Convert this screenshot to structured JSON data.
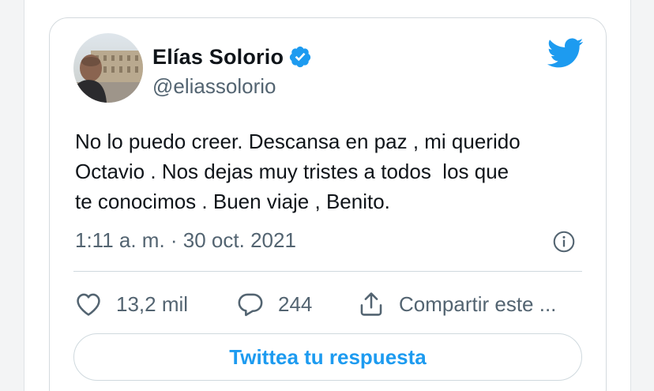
{
  "author": {
    "name": "Elías Solorio",
    "handle": "@eliassolorio",
    "verified": true,
    "avatar_icon": "profile-photo"
  },
  "tweet": {
    "text": "No lo puedo creer. Descansa en paz , mi querido\nOctavio . Nos dejas muy tristes a todos  los que\nte conocimos . Buen viaje , Benito.",
    "timestamp": "1:11 a. m. · 30 oct. 2021"
  },
  "actions": {
    "likes": "13,2 mil",
    "replies": "244",
    "share_label": "Compartir este ..."
  },
  "reply_button_label": "Twittea tu respuesta",
  "colors": {
    "brand_blue": "#1d9bf0",
    "text_primary": "#0f1419",
    "text_secondary": "#536471"
  },
  "icons": [
    "twitter-bird-icon",
    "verified-badge-icon",
    "info-icon",
    "heart-icon",
    "reply-icon",
    "share-icon"
  ]
}
